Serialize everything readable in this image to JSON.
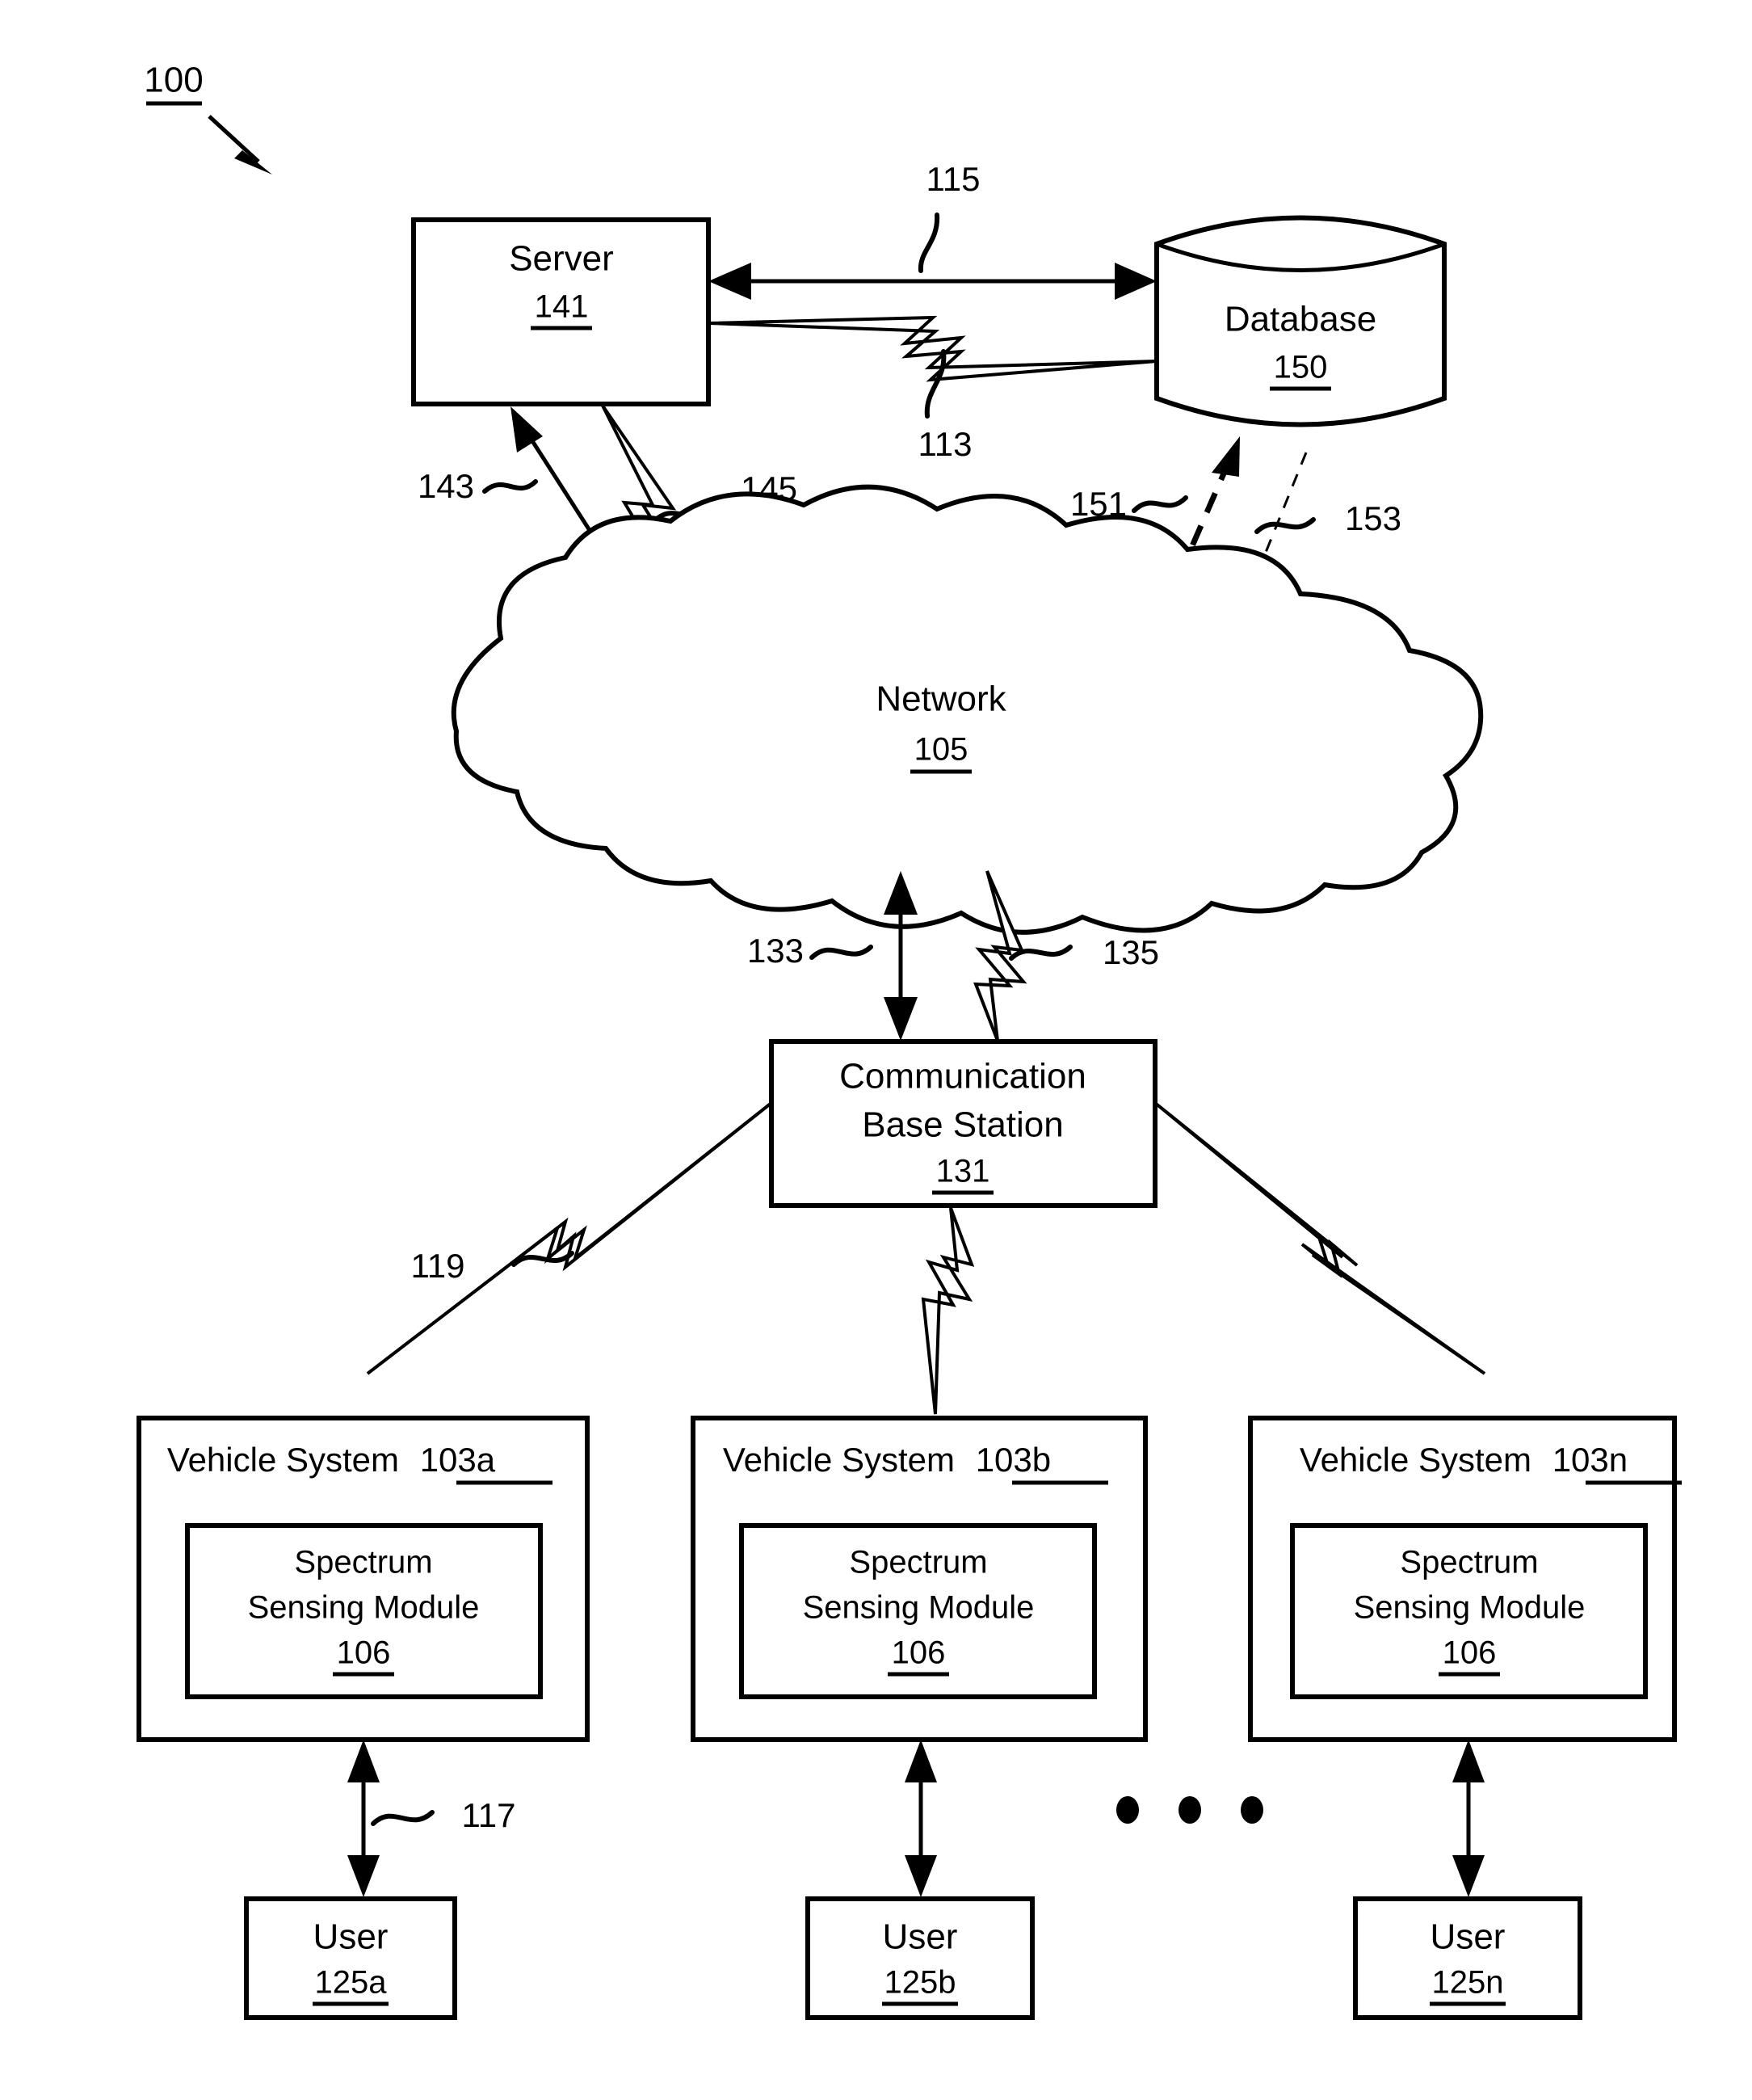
{
  "figure": {
    "number": "100",
    "type": "patent-system-diagram"
  },
  "nodes": {
    "server": {
      "title": "Server",
      "ref": "141"
    },
    "database": {
      "title": "Database",
      "ref": "150"
    },
    "network": {
      "title": "Network",
      "ref": "105"
    },
    "base_station": {
      "title_line1": "Communication",
      "title_line2": "Base Station",
      "ref": "131"
    },
    "vehicle_systems": [
      {
        "title": "Vehicle System",
        "ref": "103a",
        "module": {
          "title_line1": "Spectrum",
          "title_line2": "Sensing Module",
          "ref": "106"
        },
        "user": {
          "title": "User",
          "ref": "125a"
        }
      },
      {
        "title": "Vehicle System",
        "ref": "103b",
        "module": {
          "title_line1": "Spectrum",
          "title_line2": "Sensing Module",
          "ref": "106"
        },
        "user": {
          "title": "User",
          "ref": "125b"
        }
      },
      {
        "title": "Vehicle System",
        "ref": "103n",
        "module": {
          "title_line1": "Spectrum",
          "title_line2": "Sensing Module",
          "ref": "106"
        },
        "user": {
          "title": "User",
          "ref": "125n"
        }
      }
    ]
  },
  "connection_labels": {
    "server_database_arrow": "115",
    "server_database_wireless": "113",
    "server_network_arrow": "143",
    "server_network_wireless": "145",
    "database_network_dashed": "151",
    "database_network_dotted": "153",
    "network_base_arrow": "133",
    "network_base_wireless": "135",
    "base_vehicle_wireless": "119",
    "vehicle_user_arrow": "117"
  },
  "ellipsis": "•  •  •",
  "colors": {
    "line": "#000000",
    "background": "#ffffff"
  }
}
